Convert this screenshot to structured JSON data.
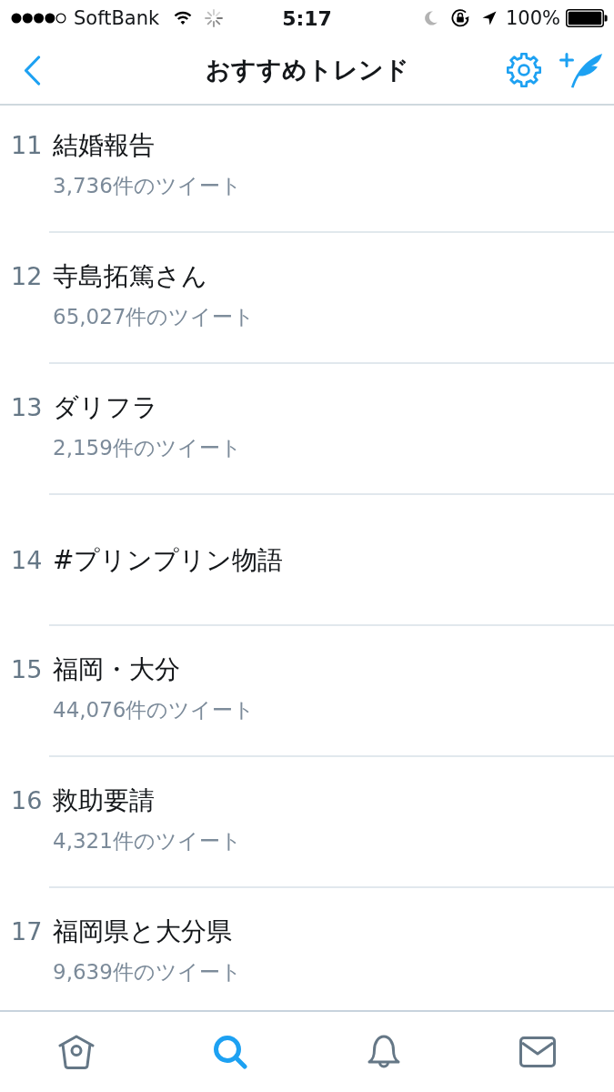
{
  "status_bar": {
    "carrier": "SoftBank",
    "time": "5:17",
    "battery": "100%"
  },
  "nav": {
    "title": "おすすめトレンド"
  },
  "trends": [
    {
      "rank": "11",
      "name": "結婚報告",
      "tweets": "3,736件のツイート"
    },
    {
      "rank": "12",
      "name": "寺島拓篤さん",
      "tweets": "65,027件のツイート"
    },
    {
      "rank": "13",
      "name": "ダリフラ",
      "tweets": "2,159件のツイート"
    },
    {
      "rank": "14",
      "name": "#プリンプリン物語"
    },
    {
      "rank": "15",
      "name": "福岡・大分",
      "tweets": "44,076件のツイート"
    },
    {
      "rank": "16",
      "name": "救助要請",
      "tweets": "4,321件のツイート"
    },
    {
      "rank": "17",
      "name": "福岡県と大分県",
      "tweets": "9,639件のツイート"
    }
  ],
  "tabs": [
    {
      "kind": "home",
      "selected": false
    },
    {
      "kind": "search",
      "selected": true
    },
    {
      "kind": "notifications",
      "selected": false
    },
    {
      "kind": "messages",
      "selected": false
    }
  ]
}
